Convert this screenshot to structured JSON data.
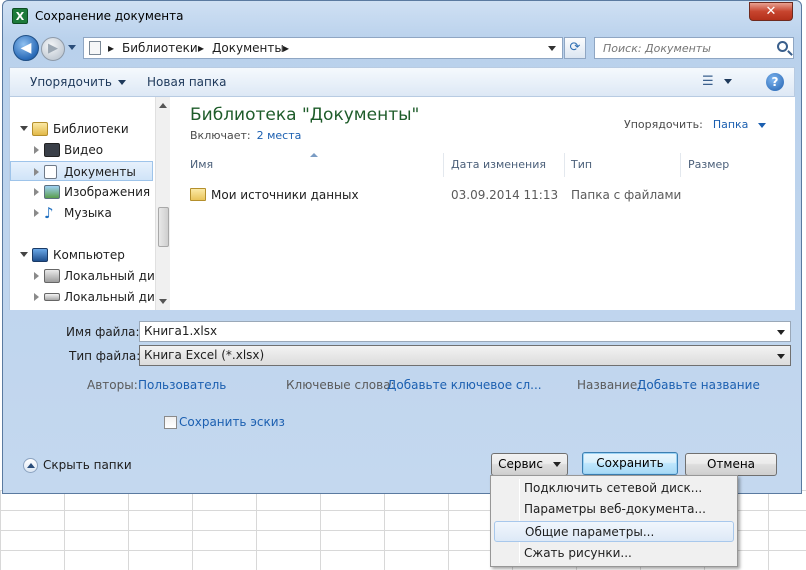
{
  "window": {
    "title": "Сохранение документа",
    "close": "✕"
  },
  "nav": {
    "address_segments": [
      "Библиотеки",
      "Документы"
    ],
    "search_placeholder": "Поиск: Документы"
  },
  "toolbar": {
    "organize": "Упорядочить",
    "new_folder": "Новая папка"
  },
  "navpane": {
    "items": [
      {
        "label": "Библиотеки"
      },
      {
        "label": "Видео"
      },
      {
        "label": "Документы"
      },
      {
        "label": "Изображения"
      },
      {
        "label": "Музыка"
      },
      {
        "label": "Компьютер"
      },
      {
        "label": "Локальный диск"
      },
      {
        "label": "Локальный диск"
      }
    ]
  },
  "content": {
    "library_title": "Библиотека \"Документы\"",
    "includes_label": "Включает:",
    "includes_link": "2 места",
    "arrange_label": "Упорядочить:",
    "arrange_value": "Папка",
    "columns": [
      "Имя",
      "Дата изменения",
      "Тип",
      "Размер"
    ],
    "files": [
      {
        "name": "Мои источники данных",
        "date": "03.09.2014 11:13",
        "type": "Папка с файлами",
        "size": ""
      }
    ]
  },
  "form": {
    "filename_label": "Имя файла:",
    "filename_value": "Книга1.xlsx",
    "filetype_label": "Тип файла:",
    "filetype_value": "Книга Excel (*.xlsx)",
    "authors_label": "Авторы:",
    "authors_value": "Пользователь",
    "keywords_label": "Ключевые слова:",
    "keywords_value": "Добавьте ключевое сл...",
    "title_label": "Название:",
    "title_value": "Добавьте название",
    "thumbnail_label": "Сохранить эскиз",
    "hide_folders": "Скрыть папки"
  },
  "buttons": {
    "tools": "Сервис",
    "save": "Сохранить",
    "cancel": "Отмена"
  },
  "menu": {
    "items": [
      "Подключить сетевой диск...",
      "Параметры веб-документа...",
      "Общие параметры...",
      "Сжать рисунки..."
    ]
  }
}
